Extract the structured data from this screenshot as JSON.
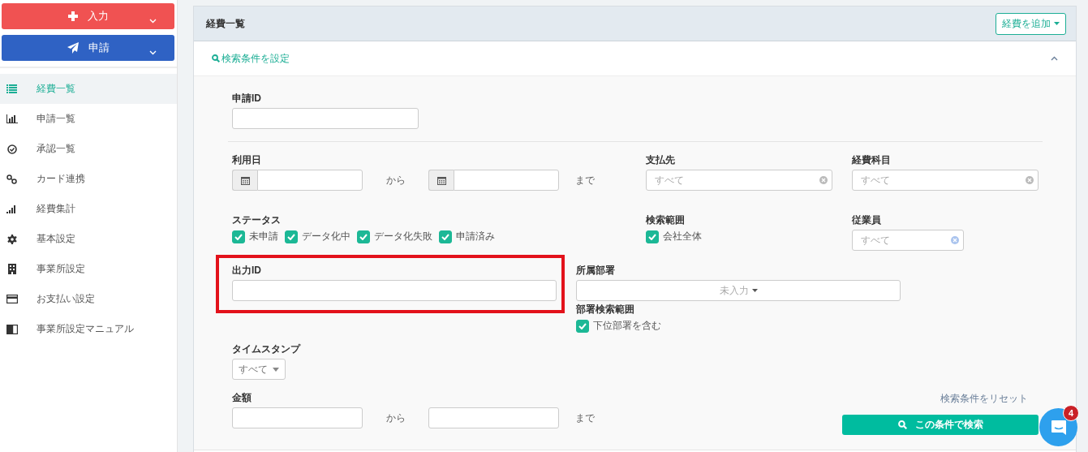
{
  "sidebar": {
    "buttons": [
      {
        "label": "入力",
        "kind": "plus",
        "color": "#f05252"
      },
      {
        "label": "申請",
        "kind": "send",
        "color": "#2f62c4"
      }
    ],
    "items": [
      {
        "label": "経費一覧",
        "kind": "list",
        "selected": true
      },
      {
        "label": "申請一覧",
        "kind": "chart",
        "selected": false
      },
      {
        "label": "承認一覧",
        "kind": "check",
        "selected": false
      },
      {
        "label": "カード連携",
        "kind": "link",
        "selected": false
      },
      {
        "label": "経費集計",
        "kind": "signal",
        "selected": false
      },
      {
        "label": "基本設定",
        "kind": "gear",
        "selected": false
      },
      {
        "label": "事業所設定",
        "kind": "building",
        "selected": false
      },
      {
        "label": "お支払い設定",
        "kind": "card",
        "selected": false
      },
      {
        "label": "事業所設定マニュアル",
        "kind": "book",
        "selected": false
      }
    ]
  },
  "panel": {
    "title": "経費一覧",
    "add_button": "経費を追加",
    "search_toggle": {
      "label": "検索条件を設定",
      "expanded": true
    },
    "form": {
      "application_id": {
        "label": "申請ID"
      },
      "usage_date": {
        "label": "利用日",
        "from": "から",
        "to": "まで"
      },
      "payee": {
        "label": "支払先",
        "placeholder": "すべて"
      },
      "expense_category": {
        "label": "経費科目",
        "placeholder": "すべて"
      },
      "status": {
        "label": "ステータス",
        "options": [
          {
            "label": "未申請",
            "checked": true
          },
          {
            "label": "データ化中",
            "checked": true
          },
          {
            "label": "データ化失敗",
            "checked": true
          },
          {
            "label": "申請済み",
            "checked": true
          }
        ]
      },
      "search_scope": {
        "label": "検索範囲",
        "options": [
          {
            "label": "会社全体",
            "checked": true
          }
        ]
      },
      "employee": {
        "label": "従業員",
        "placeholder": "すべて"
      },
      "output_id": {
        "label": "出力ID",
        "highlighted": true
      },
      "department": {
        "label": "所属部署",
        "value": "未入力"
      },
      "department_scope": {
        "label": "部署検索範囲",
        "options": [
          {
            "label": "下位部署を含む",
            "checked": true
          }
        ]
      },
      "timestamp": {
        "label": "タイムスタンプ",
        "value": "すべて"
      },
      "amount": {
        "label": "金額",
        "from": "から",
        "to": "まで"
      },
      "reset_link": "検索条件をリセット",
      "search_button": "この条件で検索"
    }
  },
  "chat": {
    "badge": "4"
  }
}
